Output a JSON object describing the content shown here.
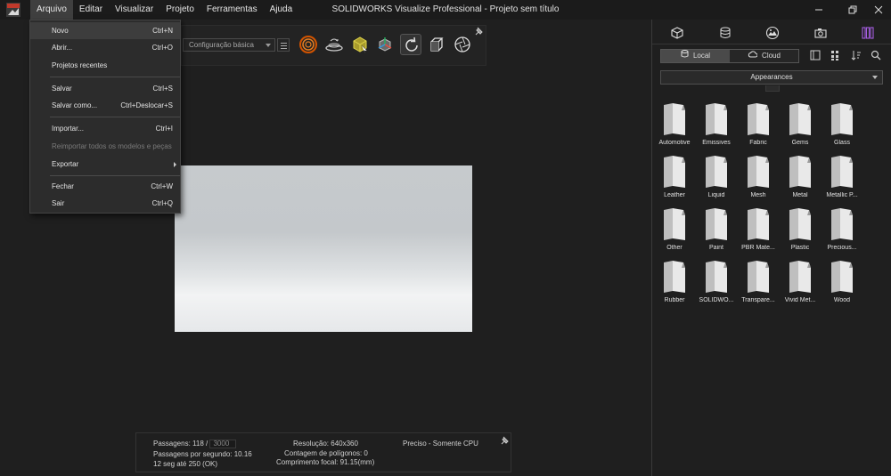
{
  "menu_bar": {
    "items": [
      "Arquivo",
      "Editar",
      "Visualizar",
      "Projeto",
      "Ferramentas",
      "Ajuda"
    ],
    "active_index": 0
  },
  "window": {
    "title": "SOLIDWORKS Visualize Professional - Projeto sem título",
    "controls": [
      "minimize-icon",
      "restore-icon",
      "close-icon"
    ]
  },
  "file_menu": {
    "items": [
      {
        "label": "Novo",
        "shortcut": "Ctrl+N",
        "highlighted": true
      },
      {
        "label": "Abrir...",
        "shortcut": "Ctrl+O"
      },
      {
        "label": "Projetos recentes",
        "shortcut": ""
      },
      {
        "label": "Salvar",
        "shortcut": "Ctrl+S"
      },
      {
        "label": "Salvar como...",
        "shortcut": "Ctrl+Deslocar+S"
      },
      {
        "label": "Importar...",
        "shortcut": "Ctrl+I"
      },
      {
        "label": "Reimportar todos os modelos e peças",
        "shortcut": "",
        "disabled": true
      },
      {
        "label": "Exportar",
        "shortcut": "",
        "submenu": true
      },
      {
        "label": "Fechar",
        "shortcut": "Ctrl+W"
      },
      {
        "label": "Sair",
        "shortcut": "Ctrl+Q"
      }
    ]
  },
  "toolbar": {
    "configuration": "Configuração básica",
    "tools": [
      "render-mode-icon",
      "turntable-icon",
      "object-select-icon",
      "transform-icon",
      "refresh-icon",
      "camera-view-icon",
      "aperture-icon"
    ]
  },
  "status": {
    "passes_label": "Passagens: 118 /",
    "passes_max": "3000",
    "passes_per_second": "Passagens por segundo: 10.16",
    "time": "12 seg até 250 (OK)",
    "resolution": "Resolução: 640x360",
    "polygon_count": "Contagem de polígonos: 0",
    "focal_length": "Comprimento focal: 91.15(mm)",
    "render_mode": "Preciso - Somente CPU"
  },
  "panel": {
    "tabs": [
      "models-icon",
      "appearances-icon",
      "scenes-icon",
      "cameras-icon",
      "libraries-icon"
    ],
    "active_tab": 4,
    "source": {
      "local": "Local",
      "cloud": "Cloud",
      "selected": "Local"
    },
    "library": "Appearances",
    "folders": [
      "Automotive",
      "Emissives",
      "Fabric",
      "Gems",
      "Glass",
      "Leather",
      "Liquid",
      "Mesh",
      "Metal",
      "Metallic P...",
      "Other",
      "Paint",
      "PBR Mate...",
      "Plastic",
      "Precious...",
      "Rubber",
      "SOLIDWO...",
      "Transpare...",
      "Vivid Met...",
      "Wood"
    ]
  },
  "colors": {
    "background": "#1e1e1e",
    "panel_accent": "#9b59d0",
    "menu_highlight": "#3d3d3d"
  }
}
